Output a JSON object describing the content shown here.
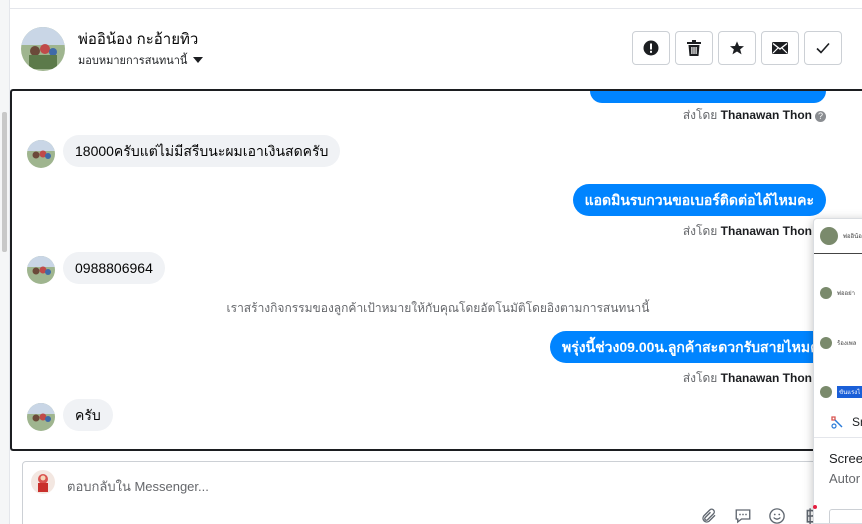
{
  "header": {
    "contact_name": "พ่ออิน้อง กะอ้ายทิว",
    "assign_label": "มอบหมายการสนทนานี้",
    "actions": [
      {
        "icon": "spam-alert-icon"
      },
      {
        "icon": "trash-icon"
      },
      {
        "icon": "star-icon"
      },
      {
        "icon": "envelope-icon"
      },
      {
        "icon": "checkmark-icon"
      }
    ]
  },
  "chat": {
    "sent_by_prefix": "ส่งโดย",
    "sender": "Thanawan Thon",
    "messages": [
      {
        "text": "18000ครับแต่ไม่มีสรีบนะผมเอาเงินสดครับ"
      },
      {
        "text": "แอดมินรบกวนขอเบอร์ติดต่อได้ไหมคะ"
      },
      {
        "text": "0988806964"
      },
      {
        "text": "พรุ่งนี้ช่วง09.00น.ลูกค้าสะดวกรับสายไหมคะ"
      },
      {
        "text": "ครับ"
      }
    ],
    "system_note": "เราสร้างกิจกรรมของลูกค้าเป้าหมายให้กับคุณโดยอัตโนมัติโดยอิงตามการสนทนานี้"
  },
  "composer": {
    "placeholder": "ตอบกลับใน Messenger...",
    "tools": [
      "paperclip-icon",
      "chat-bubble-icon",
      "emoji-icon",
      "baht-icon"
    ]
  },
  "overlay": {
    "row1": "พ่ออิน้อ",
    "row2": "พ่ออย่า",
    "row3": "ร้องเพล",
    "row4": "ขันแรงไ",
    "snip_label": "Sn",
    "screen_label": "Scree",
    "auto_label": "Autor"
  },
  "colors": {
    "outgoing_bubble": "#0084ff",
    "incoming_bubble": "#f0f2f5"
  }
}
